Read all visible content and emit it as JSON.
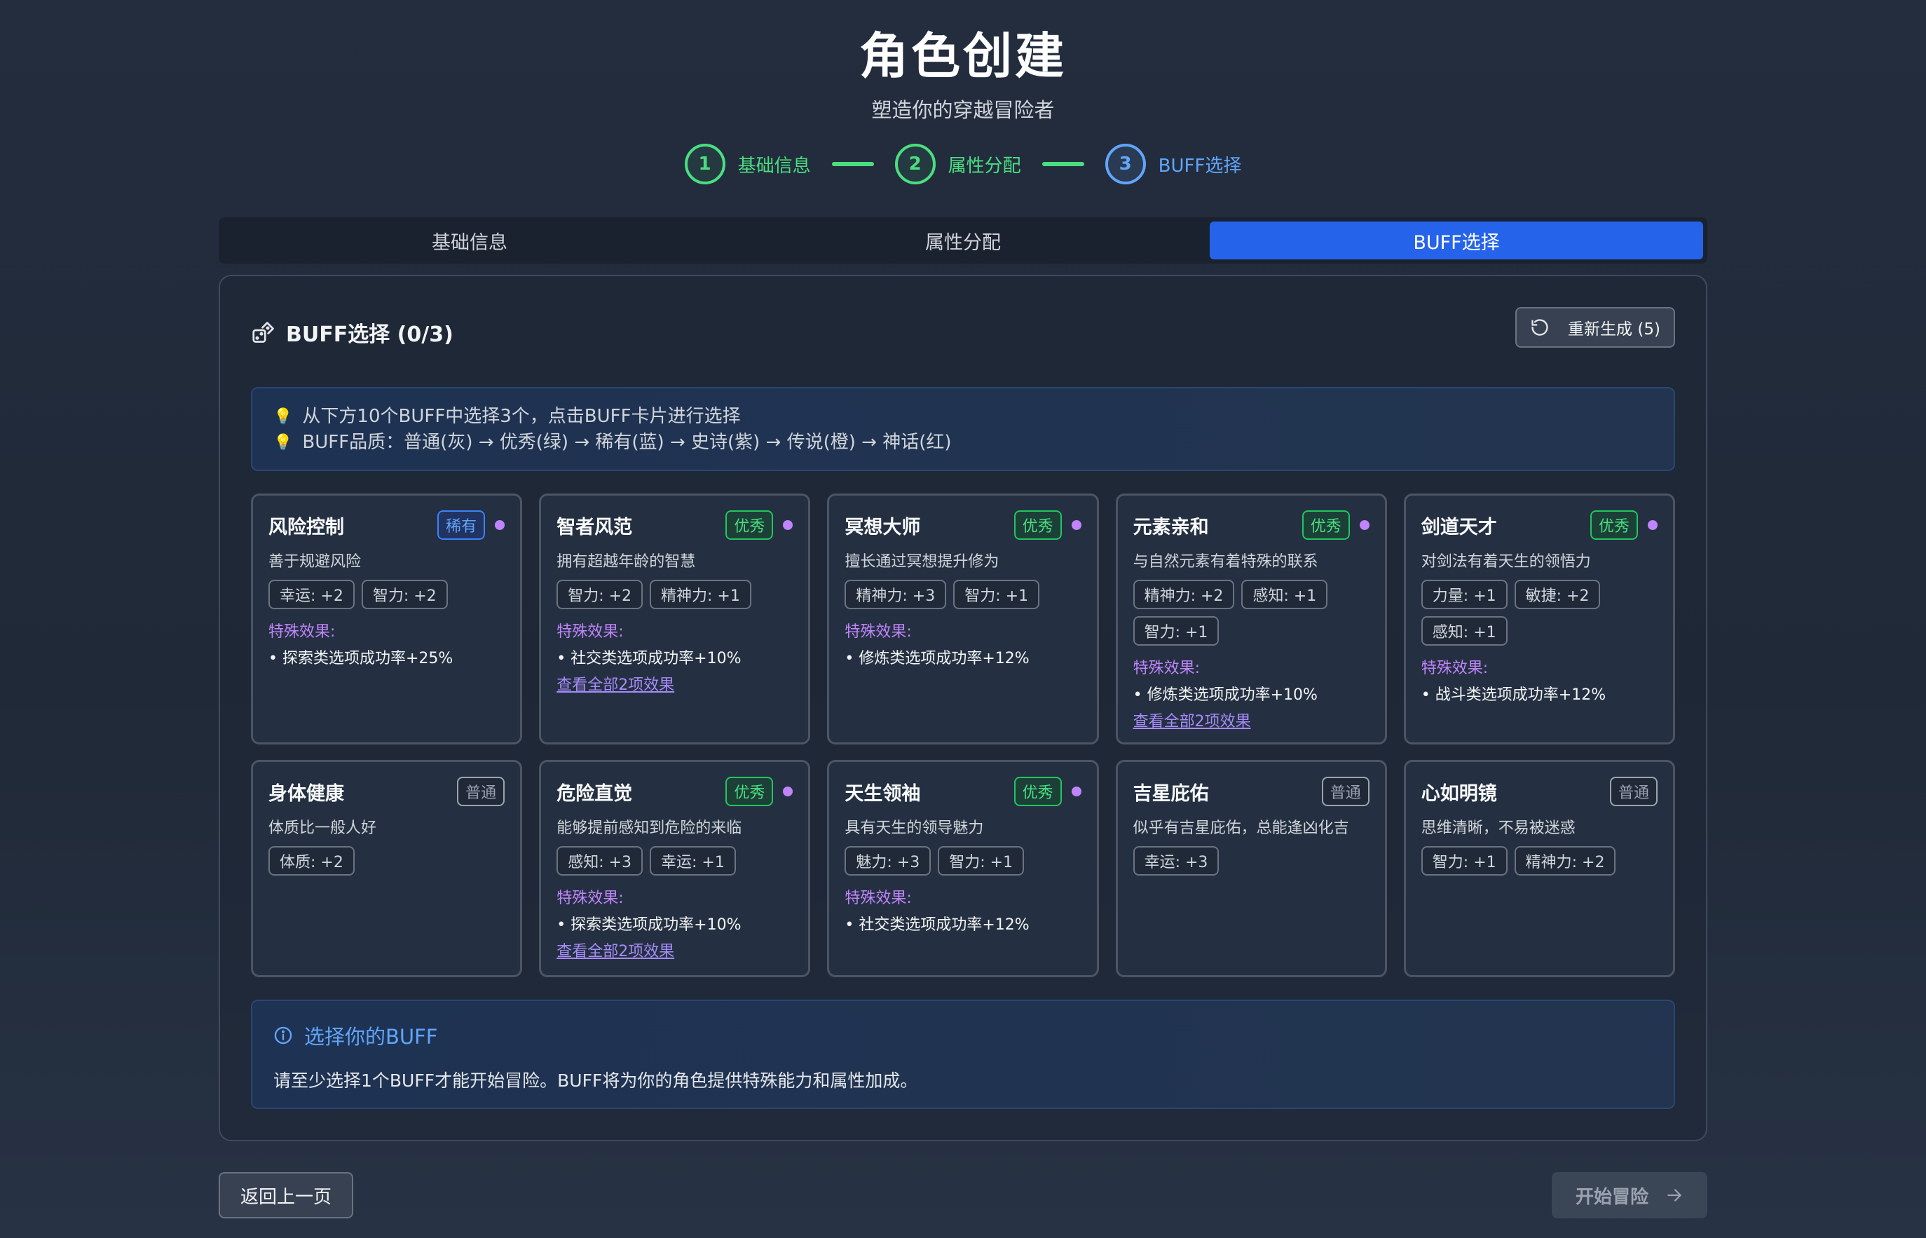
{
  "header": {
    "title": "角色创建",
    "subtitle": "塑造你的穿越冒险者"
  },
  "steps": [
    {
      "number": "1",
      "label": "基础信息"
    },
    {
      "number": "2",
      "label": "属性分配"
    },
    {
      "number": "3",
      "label": "BUFF选择"
    }
  ],
  "tabs": [
    {
      "label": "基础信息"
    },
    {
      "label": "属性分配"
    },
    {
      "label": "BUFF选择",
      "active": true
    }
  ],
  "panel": {
    "icon": "dice-icon",
    "title": "BUFF选择 (0/3)",
    "regenerate_label": "重新生成 (5)"
  },
  "tips": [
    "从下方10个BUFF中选择3个，点击BUFF卡片进行选择",
    "BUFF品质：普通(灰) → 优秀(绿) → 稀有(蓝) → 史诗(紫) → 传说(橙) → 神话(红)"
  ],
  "buffs": [
    {
      "name": "风险控制",
      "quality": "稀有",
      "desc": "善于规避风险",
      "stats": [
        "幸运: +2",
        "智力: +2"
      ],
      "effect_title": "特殊效果:",
      "effect": "• 探索类选项成功率+25%",
      "more": ""
    },
    {
      "name": "智者风范",
      "quality": "优秀",
      "desc": "拥有超越年龄的智慧",
      "stats": [
        "智力: +2",
        "精神力: +1"
      ],
      "effect_title": "特殊效果:",
      "effect": "• 社交类选项成功率+10%",
      "more": "查看全部2项效果"
    },
    {
      "name": "冥想大师",
      "quality": "优秀",
      "desc": "擅长通过冥想提升修为",
      "stats": [
        "精神力: +3",
        "智力: +1"
      ],
      "effect_title": "特殊效果:",
      "effect": "• 修炼类选项成功率+12%",
      "more": ""
    },
    {
      "name": "元素亲和",
      "quality": "优秀",
      "desc": "与自然元素有着特殊的联系",
      "stats": [
        "精神力: +2",
        "感知: +1",
        "智力: +1"
      ],
      "effect_title": "特殊效果:",
      "effect": "• 修炼类选项成功率+10%",
      "more": "查看全部2项效果"
    },
    {
      "name": "剑道天才",
      "quality": "优秀",
      "desc": "对剑法有着天生的领悟力",
      "stats": [
        "力量: +1",
        "敏捷: +2",
        "感知: +1"
      ],
      "effect_title": "特殊效果:",
      "effect": "• 战斗类选项成功率+12%",
      "more": ""
    },
    {
      "name": "身体健康",
      "quality": "普通",
      "desc": "体质比一般人好",
      "stats": [
        "体质: +2"
      ],
      "effect_title": "",
      "effect": "",
      "more": ""
    },
    {
      "name": "危险直觉",
      "quality": "优秀",
      "desc": "能够提前感知到危险的来临",
      "stats": [
        "感知: +3",
        "幸运: +1"
      ],
      "effect_title": "特殊效果:",
      "effect": "• 探索类选项成功率+10%",
      "more": "查看全部2项效果"
    },
    {
      "name": "天生领袖",
      "quality": "优秀",
      "desc": "具有天生的领导魅力",
      "stats": [
        "魅力: +3",
        "智力: +1"
      ],
      "effect_title": "特殊效果:",
      "effect": "• 社交类选项成功率+12%",
      "more": ""
    },
    {
      "name": "吉星庇佑",
      "quality": "普通",
      "desc": "似乎有吉星庇佑，总能逢凶化吉",
      "stats": [
        "幸运: +3"
      ],
      "effect_title": "",
      "effect": "",
      "more": ""
    },
    {
      "name": "心如明镜",
      "quality": "普通",
      "desc": "思维清晰，不易被迷惑",
      "stats": [
        "智力: +1",
        "精神力: +2"
      ],
      "effect_title": "",
      "effect": "",
      "more": ""
    }
  ],
  "quality_colors": {
    "普通": "#9ca3af",
    "优秀": "#4ade80",
    "稀有": "#60a5fa"
  },
  "notice": {
    "title": "选择你的BUFF",
    "text": "请至少选择1个BUFF才能开始冒险。BUFF将为你的角色提供特殊能力和属性加成。"
  },
  "footer": {
    "back_label": "返回上一页",
    "start_label": "开始冒险"
  }
}
